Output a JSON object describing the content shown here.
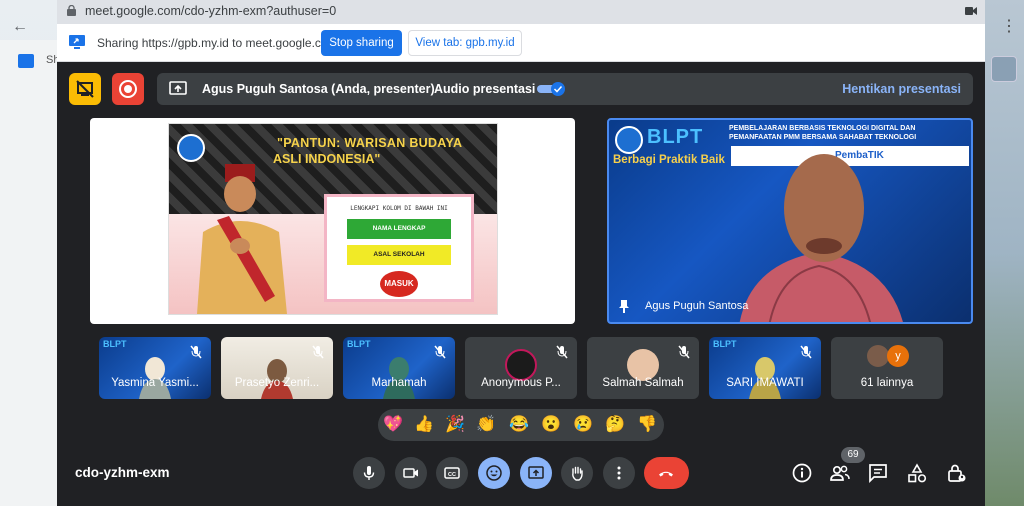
{
  "browser": {
    "url": "meet.google.com/cdo-yzhm-exm?authuser=0",
    "left_tab_text": "Sh"
  },
  "share_bar": {
    "message": "Sharing https://gpb.my.id to meet.google.com",
    "stop_label": "Stop sharing",
    "view_label": "View tab: gpb.my.id"
  },
  "presentation_bar": {
    "presenter": "Agus Puguh Santosa (Anda, presenter)",
    "audio_label": "Audio presentasi",
    "audio_enabled": true,
    "stop_label": "Hentikan presentasi"
  },
  "slide": {
    "title_line1": "\"PANTUN: WARISAN BUDAYA",
    "title_line2": "ASLI INDONESIA\"",
    "form_hint": "LENGKAPI KOLOM DI BAWAH INI",
    "field1": "NAMA LENGKAP",
    "field2": "ASAL SEKOLAH",
    "submit": "MASUK"
  },
  "presenter_tile": {
    "logo_text": "BLPT",
    "subtitle": "Berbagi Praktik Baik",
    "banner": "PEMBELAJARAN BERBASIS TEKNOLOGI DIGITAL DAN PEMANFAATAN PMM BERSAMA SAHABAT TEKNOLOGI",
    "strip_text": "PembaTIK",
    "name": "Agus Puguh Santosa"
  },
  "participants": [
    {
      "name": "Yasmina Yasmi...",
      "muted": true
    },
    {
      "name": "Prasetyo Zenri...",
      "muted": true
    },
    {
      "name": "Marhamah",
      "muted": true
    },
    {
      "name": "Anonymous P...",
      "muted": true
    },
    {
      "name": "Salmah Salmah",
      "muted": true
    },
    {
      "name": "SARI IMAWATI",
      "muted": true
    },
    {
      "name": "61 lainnya",
      "avatar_letter": "y"
    }
  ],
  "reactions": [
    "💖",
    "👍",
    "🎉",
    "👏",
    "😂",
    "😮",
    "😢",
    "🤔",
    "👎"
  ],
  "bottom": {
    "meeting_code": "cdo-yzhm-exm",
    "participant_count": "69"
  },
  "colors": {
    "accent": "#1a73e8",
    "meet_bg": "#202124",
    "control_bg": "#3c4043",
    "end_call": "#ea4335",
    "active": "#8ab4f8"
  }
}
